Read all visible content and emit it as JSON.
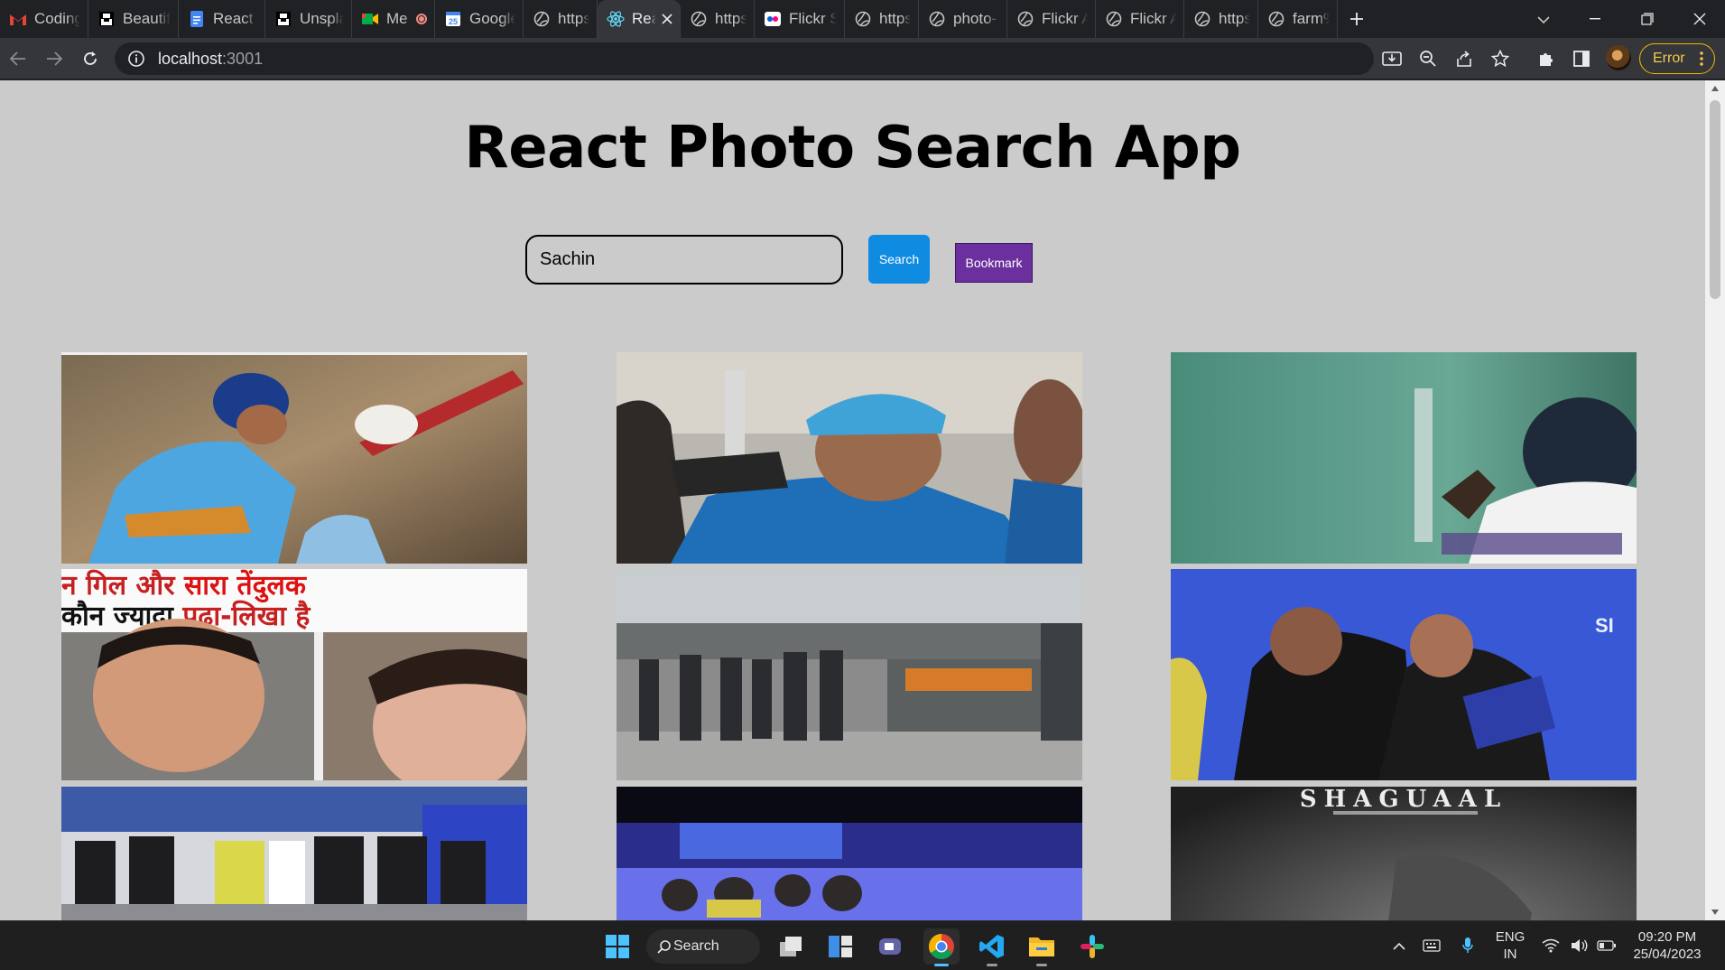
{
  "browser": {
    "tabs": [
      {
        "label": "Coding",
        "favicon": "gmail-icon",
        "color": "#ea4335"
      },
      {
        "label": "Beautif",
        "favicon": "unsplash-icon",
        "color": "#ffffff"
      },
      {
        "label": "React -",
        "favicon": "docs-icon",
        "color": "#4285f4"
      },
      {
        "label": "Unspla",
        "favicon": "unsplash-icon",
        "color": "#ffffff"
      },
      {
        "label": "Me",
        "favicon": "meet-icon",
        "color": "#00ac47"
      },
      {
        "label": "Google",
        "favicon": "calendar-icon",
        "color": "#4285f4"
      },
      {
        "label": "https://",
        "favicon": "globe-icon",
        "color": "#c4c7c5"
      },
      {
        "label": "Rea",
        "favicon": "react-icon",
        "color": "#61dafb",
        "active": true
      },
      {
        "label": "https://",
        "favicon": "globe-icon",
        "color": "#c4c7c5"
      },
      {
        "label": "Flickr S",
        "favicon": "flickr-icon",
        "color": "#ffffff"
      },
      {
        "label": "https://",
        "favicon": "globe-icon",
        "color": "#c4c7c5"
      },
      {
        "label": "photo-",
        "favicon": "globe-icon",
        "color": "#c4c7c5"
      },
      {
        "label": "Flickr A",
        "favicon": "globe-icon",
        "color": "#c4c7c5"
      },
      {
        "label": "Flickr A",
        "favicon": "globe-icon",
        "color": "#c4c7c5"
      },
      {
        "label": "https://",
        "favicon": "globe-icon",
        "color": "#c4c7c5"
      },
      {
        "label": "farm%",
        "favicon": "globe-icon",
        "color": "#c4c7c5"
      }
    ],
    "url_host": "localhost",
    "url_port": ":3001",
    "error_label": "Error"
  },
  "app": {
    "title": "React Photo Search App",
    "search_value": "Sachin",
    "search_button": "Search",
    "bookmark_button": "Bookmark",
    "photos": [
      {
        "name": "photo-batsman-blue",
        "scene": "batsman"
      },
      {
        "name": "photo-trophy-celebration",
        "scene": "trophy"
      },
      {
        "name": "photo-test-cricketer",
        "scene": "testplayer"
      },
      {
        "name": "photo-hindi-news-thumbnail",
        "scene": "news"
      },
      {
        "name": "photo-factory-group",
        "scene": "factory"
      },
      {
        "name": "photo-summit-panel",
        "scene": "panel"
      },
      {
        "name": "photo-audience-seated",
        "scene": "audience"
      },
      {
        "name": "photo-stage-event",
        "scene": "stage"
      },
      {
        "name": "photo-dark-poster",
        "scene": "poster"
      }
    ],
    "news_overlay": {
      "line1a": "न गिल और ",
      "line1b": "सारा तेंदुलक",
      "line2a": "कौन ज्यादा ",
      "line2b": "पढ़ा-लिखा है"
    },
    "poster_text": "SHAGUAAL",
    "summit_text": "SI"
  },
  "taskbar": {
    "search_label": "Search",
    "lang_line1": "ENG",
    "lang_line2": "IN",
    "time": "09:20 PM",
    "date": "25/04/2023"
  }
}
